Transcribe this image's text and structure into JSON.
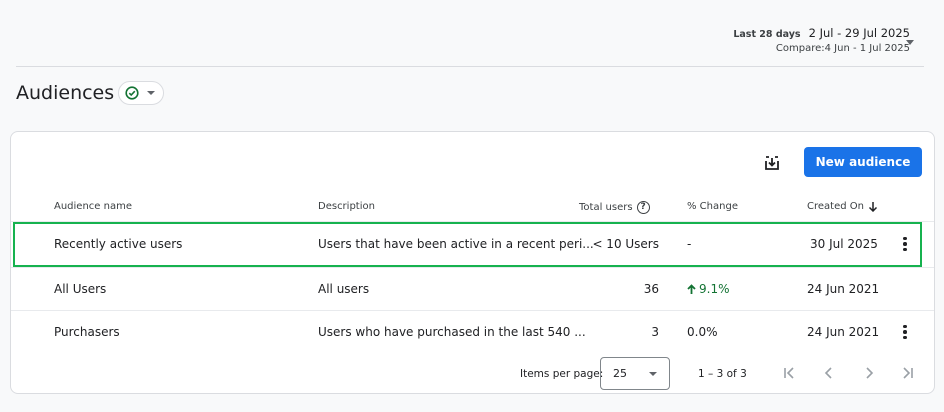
{
  "daterange": {
    "label": "Last 28 days",
    "dates": "2 Jul - 29 Jul 2025",
    "compare": "Compare:4 Jun - 1 Jul 2025"
  },
  "page": {
    "title": "Audiences"
  },
  "toolbar": {
    "new_audience": "New audience",
    "download_icon": "download-icon"
  },
  "table": {
    "headers": {
      "name": "Audience name",
      "description": "Description",
      "total_users": "Total users",
      "change": "% Change",
      "created": "Created On"
    },
    "rows": [
      {
        "name": "Recently active users",
        "description": "Users that have been active in a recent peri...",
        "total_users": "< 10 Users",
        "change": "-",
        "created": "30 Jul 2025"
      },
      {
        "name": "All Users",
        "description": "All users",
        "total_users": "36",
        "change": "9.1%",
        "created": "24 Jun 2021"
      },
      {
        "name": "Purchasers",
        "description": "Users who have purchased in the last 540 ...",
        "total_users": "3",
        "change": "0.0%",
        "created": "24 Jun 2021"
      }
    ]
  },
  "pagination": {
    "items_per_page_label": "Items per page:",
    "items_per_page": "25",
    "range": "1 – 3 of 3"
  },
  "colors": {
    "accent": "#1a73e8",
    "highlight": "#16b24f",
    "positive": "#137333"
  }
}
